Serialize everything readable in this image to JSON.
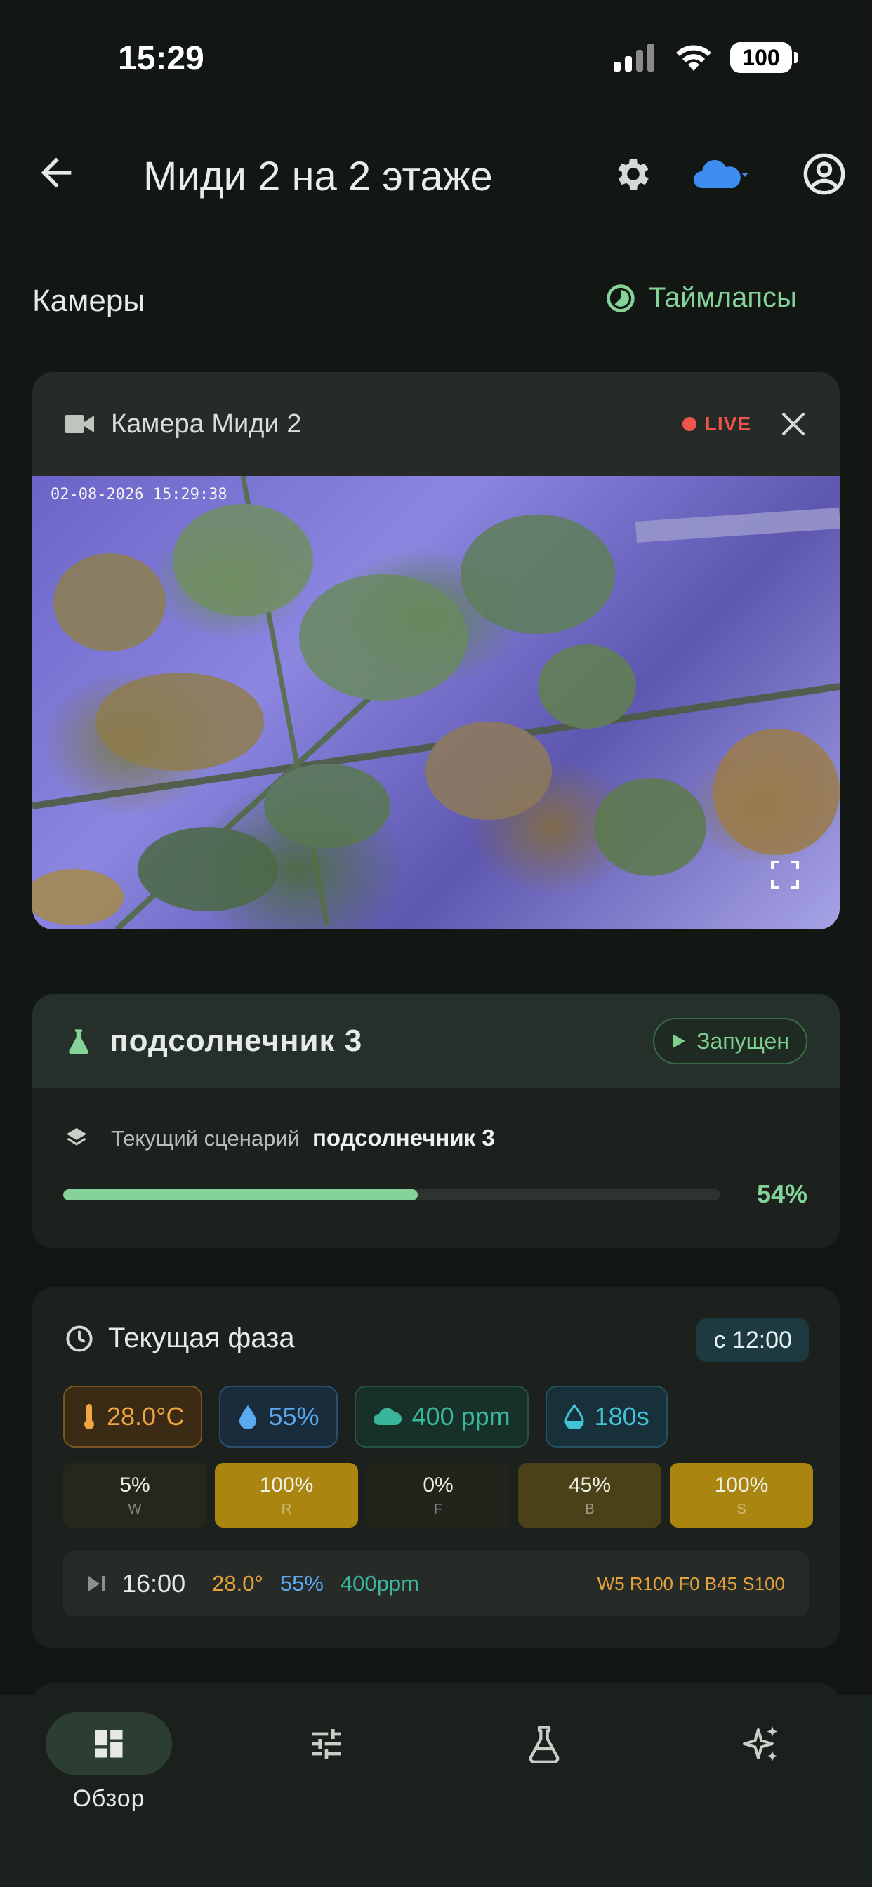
{
  "status_bar": {
    "time": "15:29",
    "battery": "100"
  },
  "header": {
    "title": "Миди 2 на 2 этаже"
  },
  "cameras_section": {
    "title": "Камеры",
    "timelapses_label": "Таймлапсы"
  },
  "camera": {
    "name": "Камера Миди 2",
    "live_label": "LIVE",
    "timestamp": "02-08-2026 15:29:38"
  },
  "experiment": {
    "name": "подсолнечник 3",
    "status": "Запущен",
    "scenario_label": "Текущий сценарий",
    "scenario_value": "подсолнечник 3",
    "progress_label": "54%",
    "progress": 0.54
  },
  "phase": {
    "title": "Текущая фаза",
    "start_time": "с 12:00",
    "metrics": {
      "temperature": "28.0°C",
      "humidity": "55%",
      "co2": "400 ppm",
      "watering": "180s"
    },
    "spectrum": [
      {
        "value": "5%",
        "channel": "W",
        "level": 0.05
      },
      {
        "value": "100%",
        "channel": "R",
        "level": 1.0
      },
      {
        "value": "0%",
        "channel": "F",
        "level": 0.0
      },
      {
        "value": "45%",
        "channel": "B",
        "level": 0.45
      },
      {
        "value": "100%",
        "channel": "S",
        "level": 1.0
      }
    ],
    "next": {
      "time": "16:00",
      "temperature": "28.0°",
      "humidity": "55%",
      "co2": "400ppm",
      "spectrum": "W5 R100 F0 B45 S100"
    }
  },
  "nav": {
    "overview_label": "Обзор",
    "active": "overview"
  },
  "colors": {
    "accent_green": "#86d39a",
    "live_red": "#f0544c",
    "cloud_blue": "#3d8ef0",
    "amber": "#e6a33c"
  },
  "icons": [
    "back-arrow-icon",
    "gear-icon",
    "cloud-icon",
    "account-icon",
    "timelapse-icon",
    "videocam-icon",
    "close-icon",
    "fullscreen-icon",
    "flask-icon",
    "play-icon",
    "layers-icon",
    "clock-icon",
    "thermometer-icon",
    "droplet-icon",
    "cloud-icon",
    "water-icon",
    "skip-next-icon",
    "dashboard-icon",
    "tune-icon",
    "sparkles-icon"
  ]
}
